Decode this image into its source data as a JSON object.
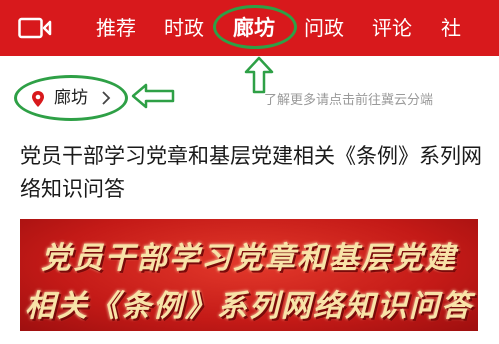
{
  "colors": {
    "brand_red": "#d8191c",
    "annotation_green": "#2ea046",
    "banner_gold": "#f8e3a8"
  },
  "nav": {
    "video_icon": "video-camera-icon",
    "tabs": [
      {
        "label": "推荐",
        "active": false
      },
      {
        "label": "时政",
        "active": false
      },
      {
        "label": "廊坊",
        "active": true
      },
      {
        "label": "问政",
        "active": false
      },
      {
        "label": "评论",
        "active": false
      },
      {
        "label": "社",
        "active": false
      }
    ]
  },
  "location": {
    "icon": "location-pin-icon",
    "name": "廊坊",
    "chevron": "chevron-right-icon"
  },
  "hint": "了解更多请点击前往冀云分端",
  "article": {
    "title": "党员干部学习党章和基层党建相关《条例》系列网络知识问答",
    "banner_line1": "党员干部学习党章和基层党建",
    "banner_line2": "相关《条例》系列网络知识问答"
  }
}
